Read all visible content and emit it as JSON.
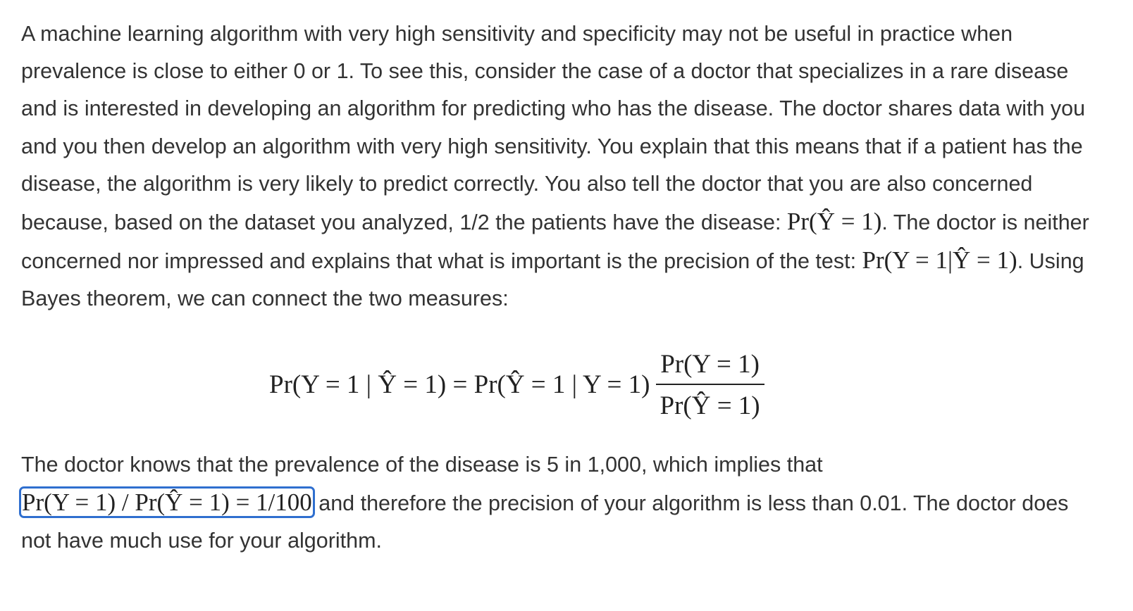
{
  "paragraph1": {
    "text_a": "A machine learning algorithm with very high sensitivity and specificity may not be useful in practice when prevalence is close to either 0 or 1. To see this, consider the case of a doctor that specializes in a rare disease and is interested in developing an algorithm for predicting who has the disease. The doctor shares data with you and you then develop an algorithm with very high sensitivity. You explain that this means that if a patient has the disease, the algorithm is very likely to predict correctly. You also tell the doctor that you are also concerned because, based on the dataset you analyzed, 1/2 the patients have the disease: ",
    "math_a": "Pr(Ŷ = 1)",
    "text_b": ". The doctor is neither concerned nor impressed and explains that what is important is the precision of the test: ",
    "math_b": "Pr(Y = 1|Ŷ = 1)",
    "text_c": ". Using Bayes theorem, we can connect the two measures:"
  },
  "equation": {
    "lhs": "Pr(Y = 1 | Ŷ = 1) = Pr(Ŷ = 1 | Y = 1)",
    "numerator": "Pr(Y = 1)",
    "denominator": "Pr(Ŷ = 1)"
  },
  "paragraph2": {
    "text_a": "The doctor knows that the prevalence of the disease is 5 in 1,000, which implies that",
    "math_a": "Pr(Y = 1) / Pr(Ŷ = 1) = 1/100",
    "text_b": " and therefore the precision of your algorithm is less than 0.01. The doctor does not have much use for your algorithm."
  },
  "colors": {
    "text": "#333333",
    "focus_outline": "#2f6fcf"
  }
}
